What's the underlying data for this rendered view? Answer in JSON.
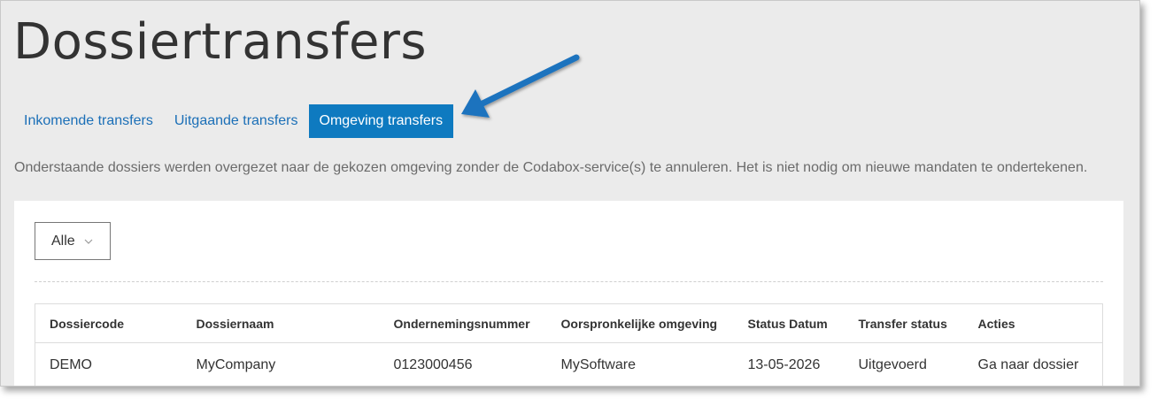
{
  "page": {
    "title": "Dossiertransfers"
  },
  "tabs": [
    {
      "label": "Inkomende transfers",
      "active": false
    },
    {
      "label": "Uitgaande transfers",
      "active": false
    },
    {
      "label": "Omgeving transfers",
      "active": true
    }
  ],
  "description": "Onderstaande dossiers werden overgezet naar de gekozen omgeving zonder de Codabox-service(s) te annuleren. Het is niet nodig om nieuwe mandaten te ondertekenen.",
  "filter": {
    "selected": "Alle",
    "icon": "chevron-down-icon"
  },
  "table": {
    "columns": [
      "Dossiercode",
      "Dossiernaam",
      "Ondernemingsnummer",
      "Oorspronkelijke omgeving",
      "Status Datum",
      "Transfer status",
      "Acties"
    ],
    "rows": [
      [
        "DEMO",
        "MyCompany",
        "0123000456",
        "MySoftware",
        "13-05-2026",
        "Uitgevoerd",
        "Ga naar dossier"
      ]
    ]
  },
  "colors": {
    "accent": "#0e7ac0",
    "link": "#1b6fb7",
    "arrow": "#1e73be"
  },
  "annotation": {
    "icon": "arrow-pointer-icon"
  }
}
